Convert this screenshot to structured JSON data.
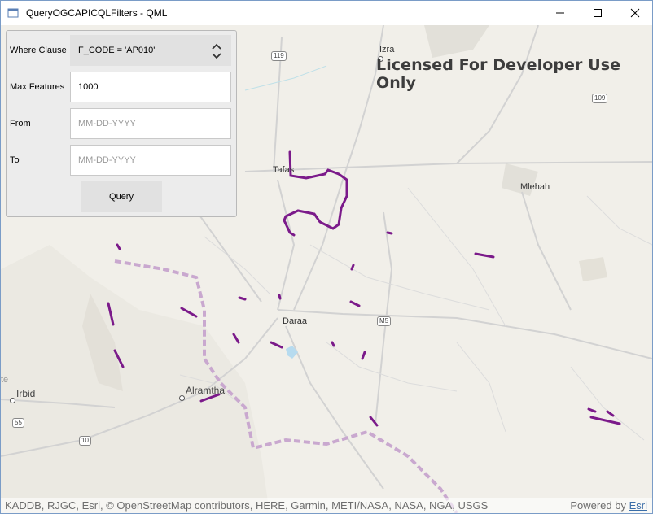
{
  "window": {
    "title": "QueryOGCAPICQLFilters - QML",
    "minimize_glyph": "—",
    "maximize_glyph": "☐",
    "close_glyph": "✕"
  },
  "form": {
    "where_clause_label": "Where Clause",
    "where_clause_value": "F_CODE = 'AP010'",
    "max_features_label": "Max Features",
    "max_features_value": "1000",
    "from_label": "From",
    "from_placeholder": "MM-DD-YYYY",
    "to_label": "To",
    "to_placeholder": "MM-DD-YYYY",
    "query_button": "Query"
  },
  "map": {
    "license_text": "Licensed For Developer Use Only",
    "attribution": "KADDB, RJGC, Esri, © OpenStreetMap contributors, HERE, Garmin, METI/NASA, NASA, NGA, USGS",
    "powered_by": "Powered by",
    "powered_by_link": "Esri",
    "places": {
      "izra": "Izra",
      "tafas": "Tafas",
      "mlehah": "Mlehah",
      "daraa": "Daraa",
      "irbid": "Irbid",
      "alramtha": "Alramtha",
      "partial_te": "te"
    },
    "shields": {
      "r119": "119",
      "r109": "109",
      "m5": "M5",
      "r55": "55",
      "r10": "10"
    },
    "feature_color": "#7b1a8a",
    "border_color": "#c9a8cf"
  }
}
